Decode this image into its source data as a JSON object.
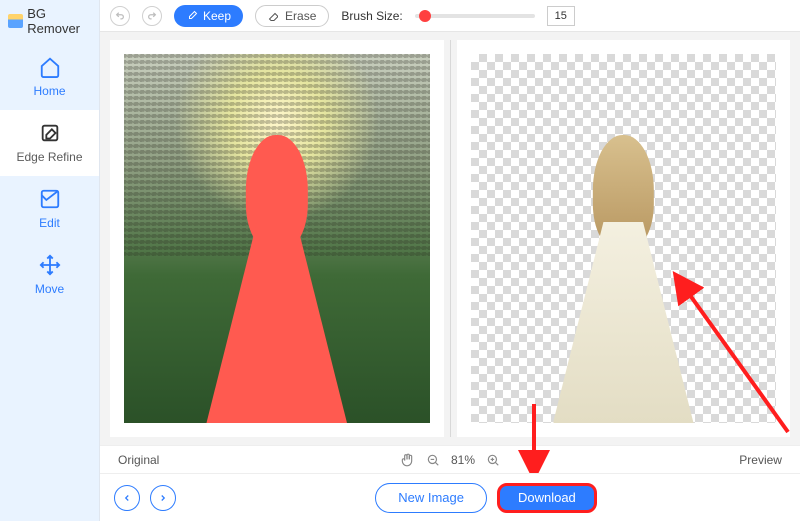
{
  "logo_text": "BG Remover",
  "sidebar": {
    "items": [
      {
        "label": "Home"
      },
      {
        "label": "Edge Refine"
      },
      {
        "label": "Edit"
      },
      {
        "label": "Move"
      }
    ]
  },
  "toolbar": {
    "keep_label": "Keep",
    "erase_label": "Erase",
    "brush_label": "Brush Size:",
    "brush_value": "15"
  },
  "zoom_row": {
    "original_label": "Original",
    "zoom_percent": "81%",
    "preview_label": "Preview"
  },
  "bottom": {
    "new_image_label": "New Image",
    "download_label": "Download"
  }
}
